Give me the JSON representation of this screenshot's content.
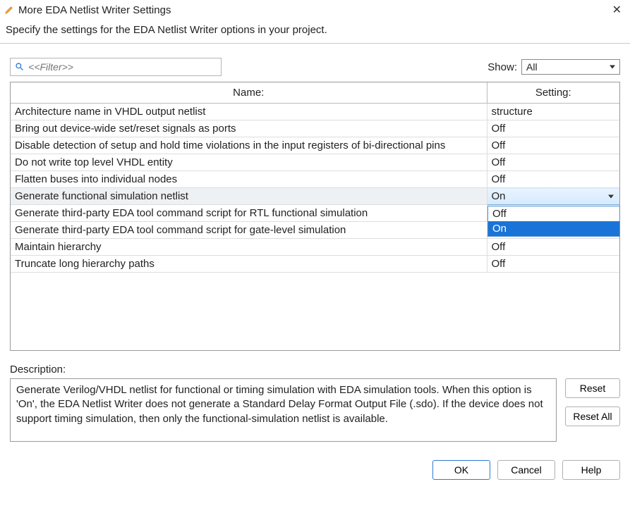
{
  "window": {
    "title": "More EDA Netlist Writer Settings",
    "subtitle": "Specify the settings for the EDA Netlist Writer options in your project."
  },
  "filter": {
    "placeholder": "<<Filter>>"
  },
  "show": {
    "label": "Show:",
    "value": "All"
  },
  "columns": {
    "name": "Name:",
    "setting": "Setting:"
  },
  "rows": [
    {
      "name": "Architecture name in VHDL output netlist",
      "setting": "structure"
    },
    {
      "name": "Bring out device-wide set/reset signals as ports",
      "setting": "Off"
    },
    {
      "name": "Disable detection of setup and hold time violations in the input registers of bi-directional pins",
      "setting": "Off"
    },
    {
      "name": "Do not write top level VHDL entity",
      "setting": "Off"
    },
    {
      "name": "Flatten buses into individual nodes",
      "setting": "Off"
    },
    {
      "name": "Generate functional simulation netlist",
      "setting": "On",
      "active": true,
      "combo": {
        "options": [
          "Off",
          "On"
        ],
        "selected": "On"
      }
    },
    {
      "name": "Generate third-party EDA tool command script for RTL functional simulation",
      "setting": "Off"
    },
    {
      "name": "Generate third-party EDA tool command script for gate-level simulation",
      "setting": ""
    },
    {
      "name": "Maintain hierarchy",
      "setting": "Off"
    },
    {
      "name": "Truncate long hierarchy paths",
      "setting": "Off"
    }
  ],
  "description": {
    "label": "Description:",
    "text": "Generate Verilog/VHDL netlist for functional or timing simulation with EDA simulation tools. When this option is 'On', the EDA Netlist Writer does not generate a Standard Delay Format Output File (.sdo). If the device does not support timing simulation, then only the functional-simulation netlist is available."
  },
  "buttons": {
    "reset": "Reset",
    "reset_all": "Reset All",
    "ok": "OK",
    "cancel": "Cancel",
    "help": "Help"
  }
}
